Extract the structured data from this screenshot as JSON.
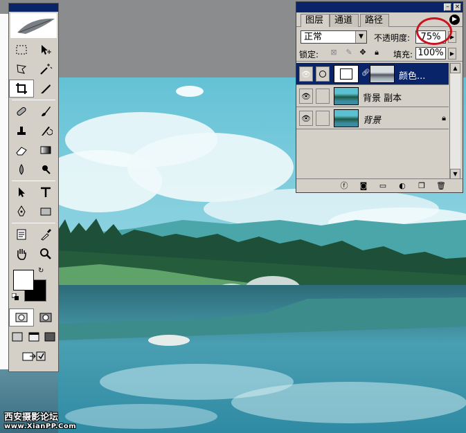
{
  "layers_panel": {
    "tabs": [
      {
        "label": "图层"
      },
      {
        "label": "通道"
      },
      {
        "label": "路径"
      }
    ],
    "blend_mode": "正常",
    "opacity_label": "不透明度:",
    "opacity_value": "75%",
    "lock_label": "锁定:",
    "fill_label": "填充:",
    "fill_value": "100%",
    "layers": [
      {
        "name": "颜色...",
        "active": true
      },
      {
        "name": "背景 副本",
        "active": false
      },
      {
        "name": "背景",
        "active": false
      }
    ]
  },
  "watermark": {
    "line1": "西安摄影论坛",
    "line2": "www.XianPP.Com"
  },
  "colors": {
    "title_bar": "#0a246a",
    "panel_bg": "#d4d0c8",
    "highlight_circle": "#c8141e"
  },
  "icons": {
    "toolbox": [
      "marquee-icon",
      "move-icon",
      "lasso-icon",
      "magic-wand-icon",
      "crop-icon",
      "slice-icon",
      "healing-brush-icon",
      "brush-icon",
      "clone-stamp-icon",
      "history-brush-icon",
      "eraser-icon",
      "gradient-icon",
      "blur-icon",
      "dodge-icon",
      "path-select-icon",
      "type-icon",
      "pen-icon",
      "shape-icon",
      "notes-icon",
      "eyedropper-icon",
      "hand-icon",
      "zoom-icon"
    ]
  }
}
